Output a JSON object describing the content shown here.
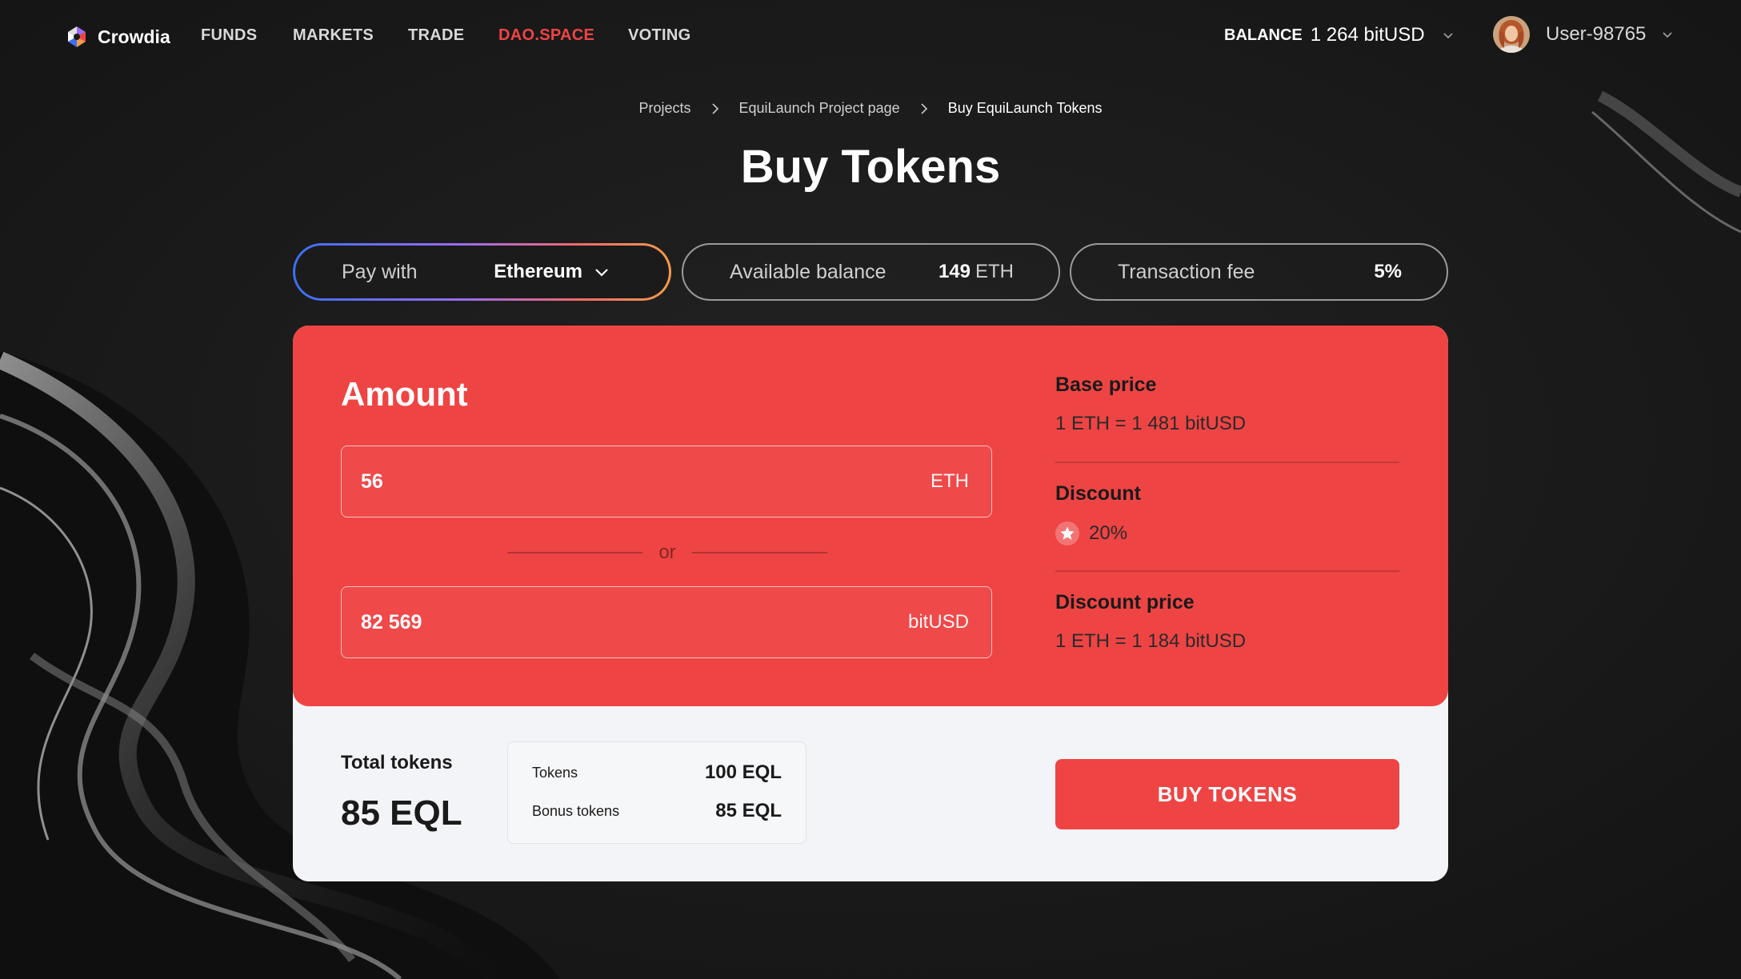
{
  "brand": {
    "name": "Crowdia"
  },
  "nav": {
    "links": [
      {
        "label": "FUNDS"
      },
      {
        "label": "MARKETS"
      },
      {
        "label": "TRADE"
      },
      {
        "label": "DAO.SPACE",
        "active": true
      },
      {
        "label": "VOTING"
      }
    ]
  },
  "header": {
    "balance_label": "BALANCE",
    "balance_value": "1 264 bitUSD",
    "username": "User-98765"
  },
  "breadcrumb": [
    "Projects",
    "EquiLaunch Project page",
    "Buy EquiLaunch Tokens"
  ],
  "page_title": "Buy Tokens",
  "pay_with": {
    "label": "Pay with",
    "value": "Ethereum"
  },
  "available_balance": {
    "label": "Available balance",
    "value": "149",
    "unit": "ETH"
  },
  "transaction_fee": {
    "label": "Transaction fee",
    "value": "5%"
  },
  "amount": {
    "title": "Amount",
    "eth_value": "56",
    "eth_unit": "ETH",
    "or": "or",
    "usd_value": "82 569",
    "usd_unit": "bitUSD"
  },
  "prices": {
    "base_label": "Base price",
    "base_value": "1 ETH = 1 481 bitUSD",
    "discount_label": "Discount",
    "discount_value": "20%",
    "discount_price_label": "Discount price",
    "discount_price_value": "1 ETH = 1 184 bitUSD"
  },
  "totals": {
    "label": "Total tokens",
    "value": "85 EQL",
    "tokens_label": "Tokens",
    "tokens_value": "100 EQL",
    "bonus_label": "Bonus tokens",
    "bonus_value": "85 EQL"
  },
  "buy_button": "BUY TOKENS",
  "colors": {
    "accent": "#ef4444",
    "background": "#1a1a1a",
    "card": "#f3f4f7"
  }
}
